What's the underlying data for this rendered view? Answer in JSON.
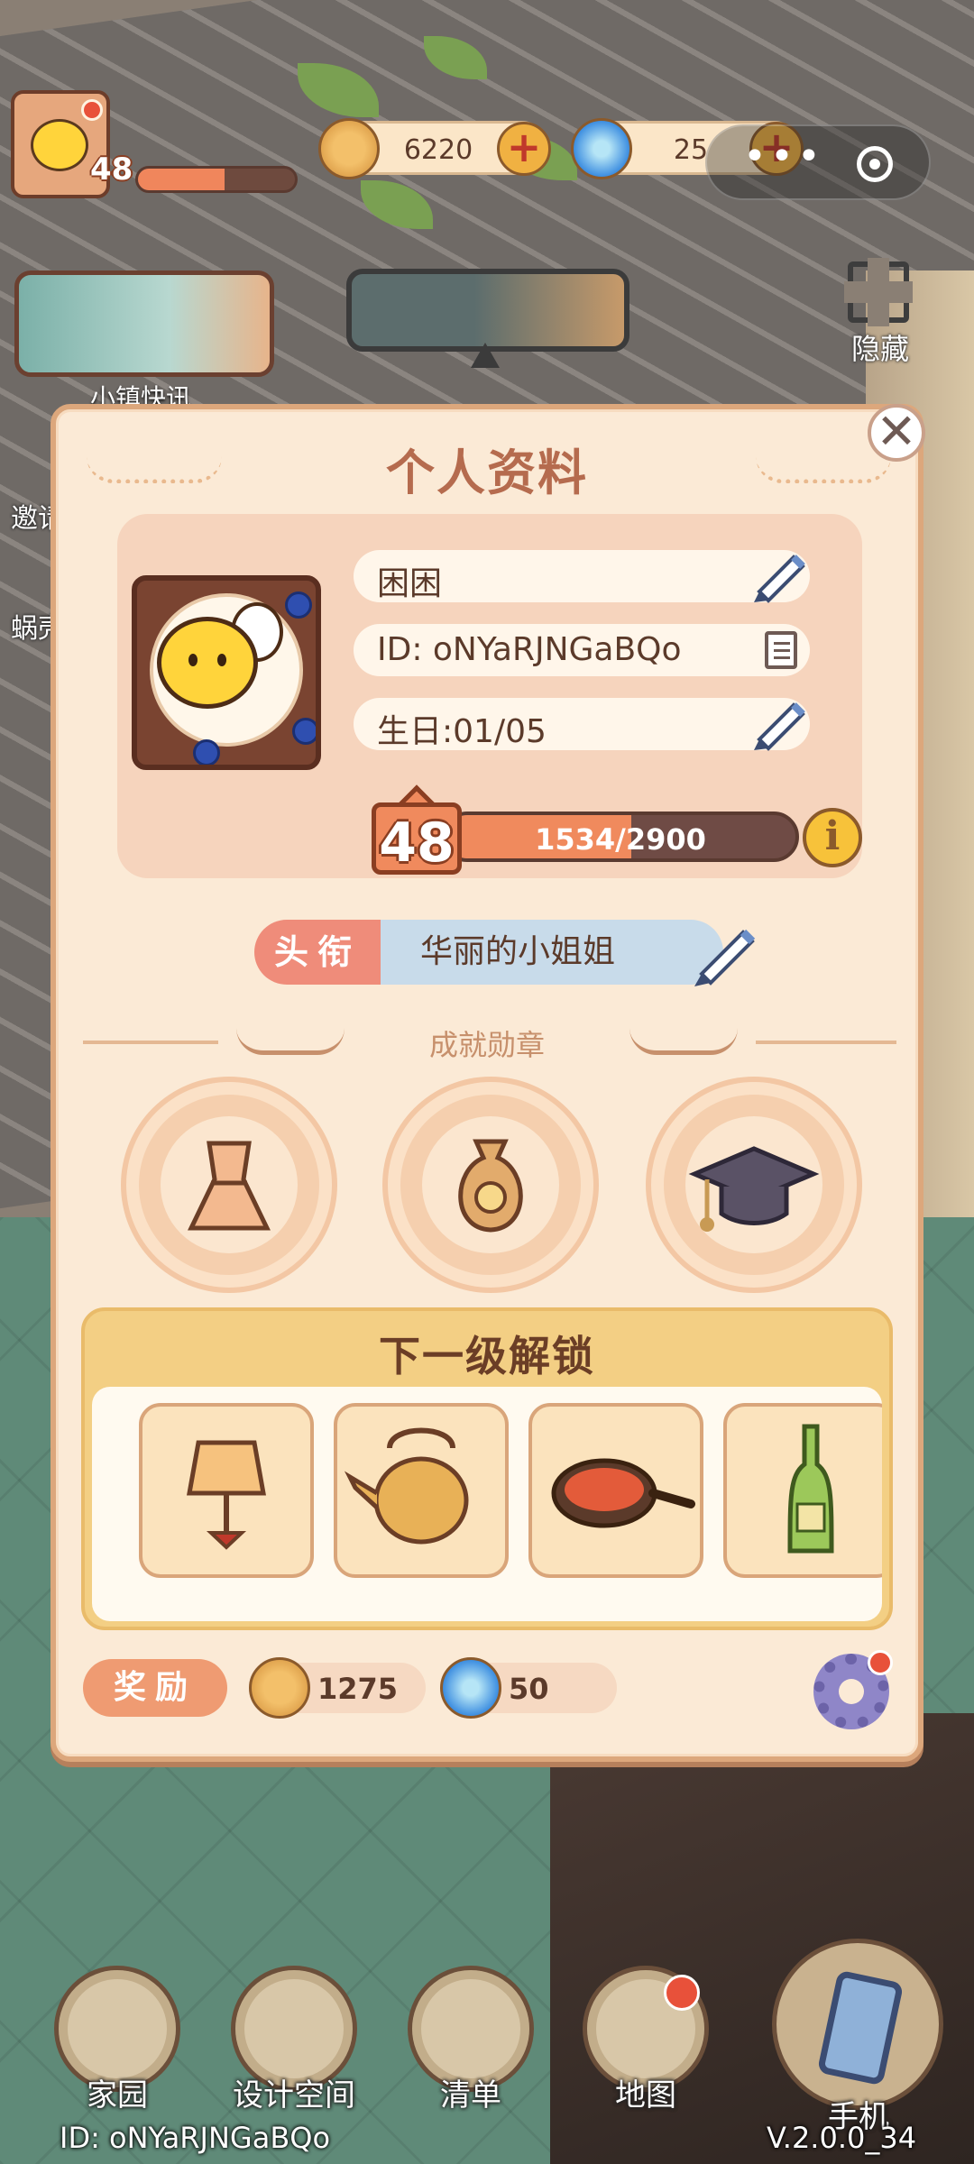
{
  "hud": {
    "level": "48",
    "xp_fraction": 0.55,
    "coins": "6220",
    "gems": "25",
    "capsule_more": "•••",
    "news_label": "小镇快讯",
    "hide_label": "隐藏",
    "side_labels": [
      "邀请",
      "蜗壳"
    ]
  },
  "profile": {
    "title": "个人资料",
    "close": "✕",
    "name": "困困",
    "id_text": "ID: oNYaRJNGaBQo",
    "birthday": "生日:01/05",
    "level": "48",
    "xp_text": "1534/2900",
    "xp_fraction": 0.53,
    "info": "i",
    "title_tag": "头衔",
    "title_value": "华丽的小姐姐",
    "medals_label": "成就勋章",
    "medals": [
      "dress-medal-icon",
      "money-bag-medal-icon",
      "graduation-cap-medal-icon"
    ],
    "unlock_head": "下一级解锁",
    "unlock_items": [
      "lamp-icon",
      "teapot-icon",
      "frying-pan-icon",
      "bottle-icon"
    ],
    "reward_tag": "奖励",
    "reward_coins": "1275",
    "reward_gems": "50"
  },
  "nav": {
    "items": [
      "家园",
      "设计空间",
      "清单",
      "地图",
      "手机"
    ],
    "bottom_id": "ID: oNYaRJNGaBQo",
    "version": "V.2.0.0_34"
  },
  "colors": {
    "panel_bg": "#fbead6",
    "title": "#b56b4e",
    "xp_fill": "#f08a5d",
    "title_tag": "#ef8c7a",
    "title_value_bg": "#c8dbea",
    "unlock_head_bg": "#f3cf84",
    "notification": "#e8513a"
  }
}
